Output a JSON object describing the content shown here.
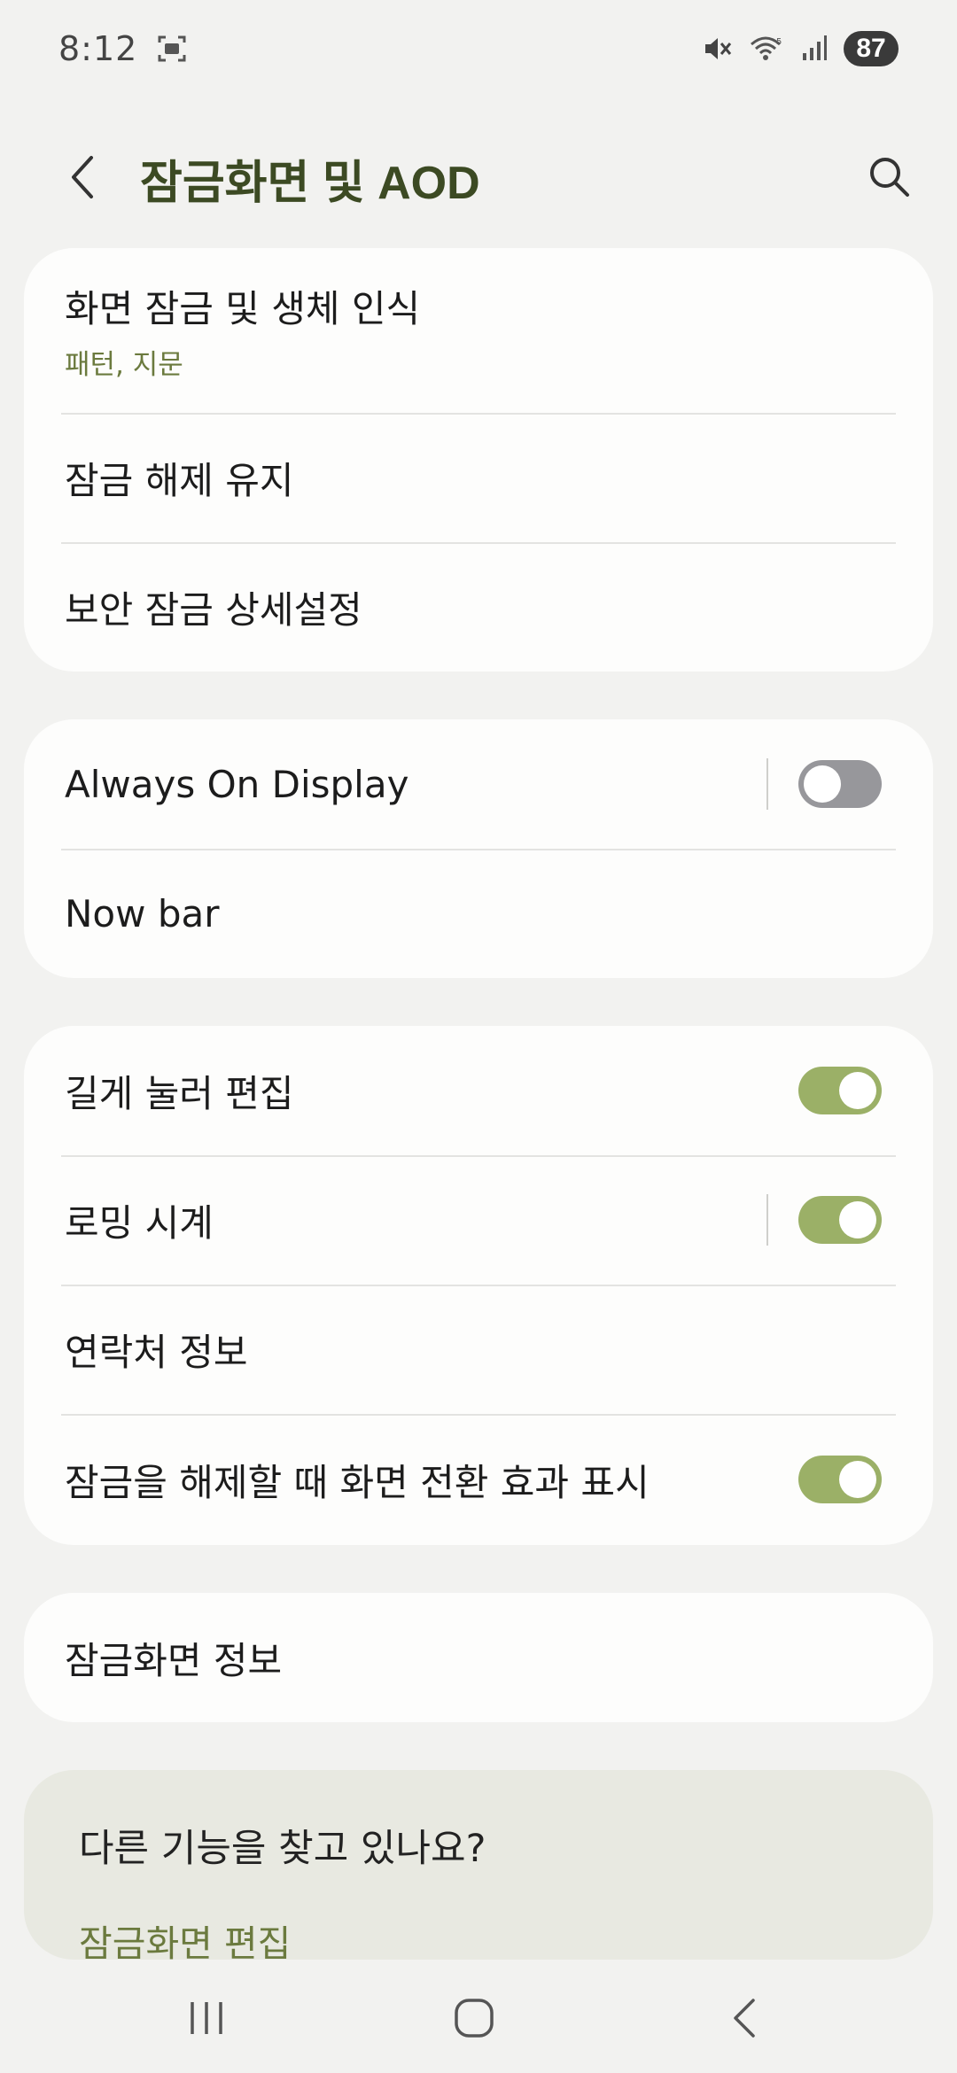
{
  "status": {
    "time": "8:12",
    "battery": "87"
  },
  "header": {
    "title": "잠금화면 및 AOD"
  },
  "card1": {
    "items": [
      {
        "label": "화면 잠금 및 생체 인식",
        "sub": "패턴, 지문"
      },
      {
        "label": "잠금 해제 유지"
      },
      {
        "label": "보안 잠금 상세설정"
      }
    ]
  },
  "card2": {
    "items": [
      {
        "label": "Always On Display",
        "toggle": "off"
      },
      {
        "label": "Now bar"
      }
    ]
  },
  "card3": {
    "items": [
      {
        "label": "길게 눌러 편집",
        "toggle": "on"
      },
      {
        "label": "로밍 시계",
        "toggle": "on"
      },
      {
        "label": "연락처 정보"
      },
      {
        "label": "잠금을 해제할 때 화면 전환 효과 표시",
        "toggle": "on"
      }
    ]
  },
  "card4": {
    "items": [
      {
        "label": "잠금화면 정보"
      }
    ]
  },
  "suggest": {
    "title": "다른 기능을 찾고 있나요?",
    "link": "잠금화면 편집"
  },
  "colors": {
    "accent": "#9bb067",
    "title": "#3c4a23",
    "sub": "#6b7a3e"
  }
}
